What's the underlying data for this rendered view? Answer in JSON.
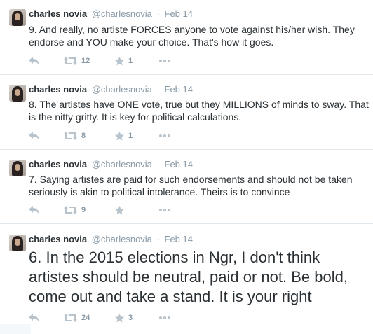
{
  "tweets": [
    {
      "author_name": "charles novia",
      "author_handle": "@charlesnovia",
      "separator": "·",
      "time": "Feb 14",
      "text": "9. And really, no artiste FORCES anyone to vote against his/her wish. They endorse and YOU make your choice. That's how it goes.",
      "retweets": "12",
      "favorites": "1"
    },
    {
      "author_name": "charles novia",
      "author_handle": "@charlesnovia",
      "separator": "·",
      "time": "Feb 14",
      "text": "8. The artistes have ONE vote, true but they MILLIONS of minds to sway. That is the nitty gritty. It is key for political calculations.",
      "retweets": "8",
      "favorites": "1"
    },
    {
      "author_name": "charles novia",
      "author_handle": "@charlesnovia",
      "separator": "·",
      "time": "Feb 14",
      "text": "7. Saying artistes are paid for such endorsements and should not be taken seriously is akin to political intolerance. Theirs is to convince",
      "retweets": "9",
      "favorites": ""
    },
    {
      "author_name": "charles novia",
      "author_handle": "@charlesnovia",
      "separator": "·",
      "time": "Feb 14",
      "text": "6. In the 2015 elections in Ngr, I don't think artistes should be neutral, paid or not. Be bold, come out and take a stand. It is your right",
      "retweets": "24",
      "favorites": "3"
    }
  ],
  "icons": {
    "reply": "reply-icon",
    "retweet": "retweet-icon",
    "favorite": "star-icon",
    "more": "more-dots-icon"
  },
  "colors": {
    "text": "#292f33",
    "muted": "#8899a6",
    "icon": "#b8c3cc",
    "divider": "#e1e8ed"
  }
}
